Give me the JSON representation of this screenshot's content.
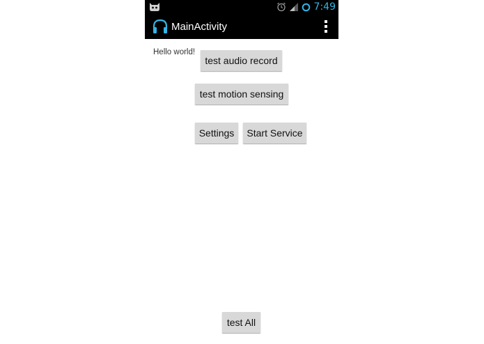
{
  "status_bar": {
    "time": "7:49",
    "icons": [
      "android-cat-icon",
      "alarm-icon",
      "signal-icon",
      "sync-ring-icon"
    ]
  },
  "action_bar": {
    "title": "MainActivity",
    "app_icon": "headphones-icon",
    "menu_icon": "overflow-menu-icon"
  },
  "content": {
    "hello_text": "Hello world!",
    "buttons": {
      "audio_record": "test audio record",
      "motion_sensing": "test motion sensing",
      "settings": "Settings",
      "start_service": "Start Service",
      "test_all": "test All"
    }
  },
  "colors": {
    "status_bar_bg": "#000000",
    "action_bar_bg": "#000000",
    "accent": "#33b5e5",
    "button_bg": "#d8d8d8"
  }
}
